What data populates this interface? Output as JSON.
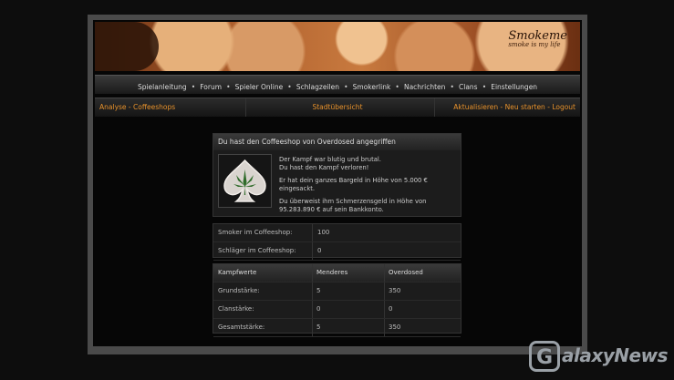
{
  "banner": {
    "logo": "Smokeme",
    "tagline": "smoke is my life"
  },
  "nav": {
    "items": [
      "Spielanleitung",
      "Forum",
      "Spieler Online",
      "Schlagzeilen",
      "Smokerlink",
      "Nachrichten",
      "Clans",
      "Einstellungen"
    ],
    "separator": "•"
  },
  "subnav": {
    "left": [
      "Analyse",
      "Coffeeshops"
    ],
    "center": "Stadtübersicht",
    "right": [
      "Aktualisieren",
      "Neu starten",
      "Logout"
    ],
    "dash": "-"
  },
  "result": {
    "title": "Du hast den Coffeeshop von Overdosed angegriffen",
    "icon": "cannabis-leaf-spade-icon",
    "line1": "Der Kampf war blutig und brutal.",
    "line2": "Du hast den Kampf verloren!",
    "line3": "Er hat dein ganzes Bargeld in Höhe von 5.000 € eingesackt.",
    "line4": "Du überweist ihm Schmerzensgeld in Höhe von 95.283.890 € auf sein Bankkonto."
  },
  "stats": [
    {
      "label": "Smoker im Coffeeshop:",
      "value": "100"
    },
    {
      "label": "Schläger im Coffeeshop:",
      "value": "0"
    }
  ],
  "fight": {
    "headers": [
      "Kampfwerte",
      "Menderes",
      "Overdosed"
    ],
    "rows": [
      [
        "Grundstärke:",
        "5",
        "350"
      ],
      [
        "Clanstärke:",
        "0",
        "0"
      ],
      [
        "Gesamtstärke:",
        "5",
        "350"
      ]
    ]
  },
  "watermark": {
    "g": "G",
    "text": "alaxyNews"
  },
  "colors": {
    "accent": "#e8922c",
    "background": "#0d0d0d",
    "frame": "#4a4a4a"
  }
}
